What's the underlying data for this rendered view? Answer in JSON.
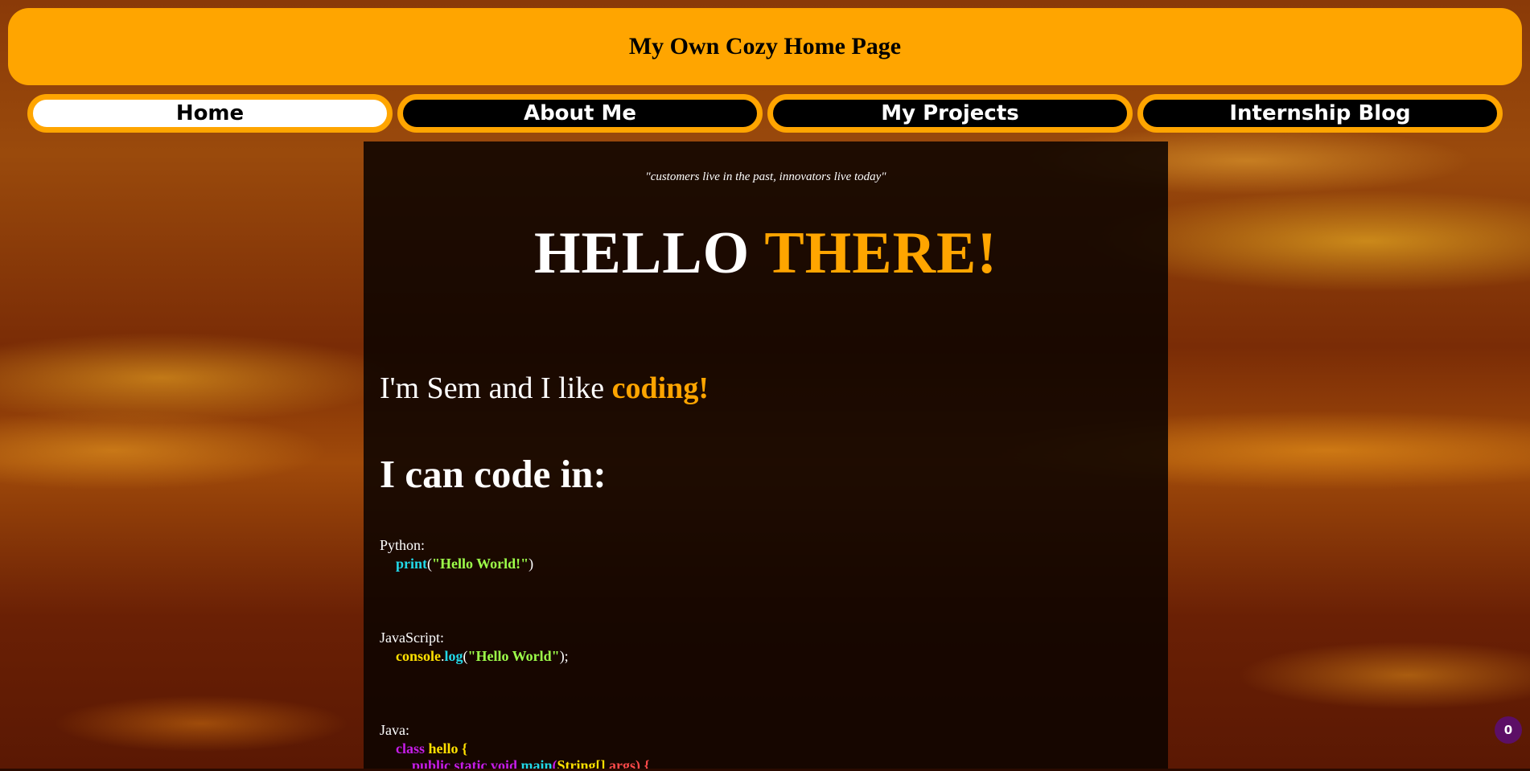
{
  "header": {
    "title": "My Own Cozy Home Page"
  },
  "nav": {
    "items": [
      {
        "label": "Home",
        "active": true
      },
      {
        "label": "About Me",
        "active": false
      },
      {
        "label": "My Projects",
        "active": false
      },
      {
        "label": "Internship Blog",
        "active": false
      }
    ]
  },
  "main": {
    "quote": "\"customers live in the past, innovators live today\"",
    "hello_white": "HELLO",
    "hello_orange": "THERE!",
    "intro_text": "I'm Sem and I like",
    "intro_highlight": "coding!",
    "can_code_heading": "I can code in:",
    "languages": [
      {
        "name": "Python:"
      },
      {
        "name": "JavaScript:"
      },
      {
        "name": "Java:"
      }
    ],
    "python_code": {
      "fn": "print",
      "open": "(",
      "str": "\"Hello World!\"",
      "close": ")"
    },
    "js_code": {
      "obj": "console",
      "dot": ".",
      "fn": "log",
      "open": "(",
      "str": "\"Hello World\"",
      "close": ");"
    },
    "java_code": {
      "line1_kw": "class",
      "line1_name": "hello {",
      "line2_kw": "public static void",
      "line2_fn": "main",
      "line2_open": "(",
      "line2_type": "String[]",
      "line2_arg": "args",
      "line2_close": ") {"
    }
  },
  "badge": {
    "count": "0"
  },
  "colors": {
    "accent": "#ffa500",
    "nav_inactive_bg": "#000000",
    "nav_active_bg": "#ffffff",
    "code_cyan": "#22d8e8",
    "code_green": "#9dff4a",
    "code_yellow": "#ffe000",
    "code_purple": "#c61de8",
    "code_red": "#ff4a4a",
    "badge_bg": "#5c0f66"
  }
}
